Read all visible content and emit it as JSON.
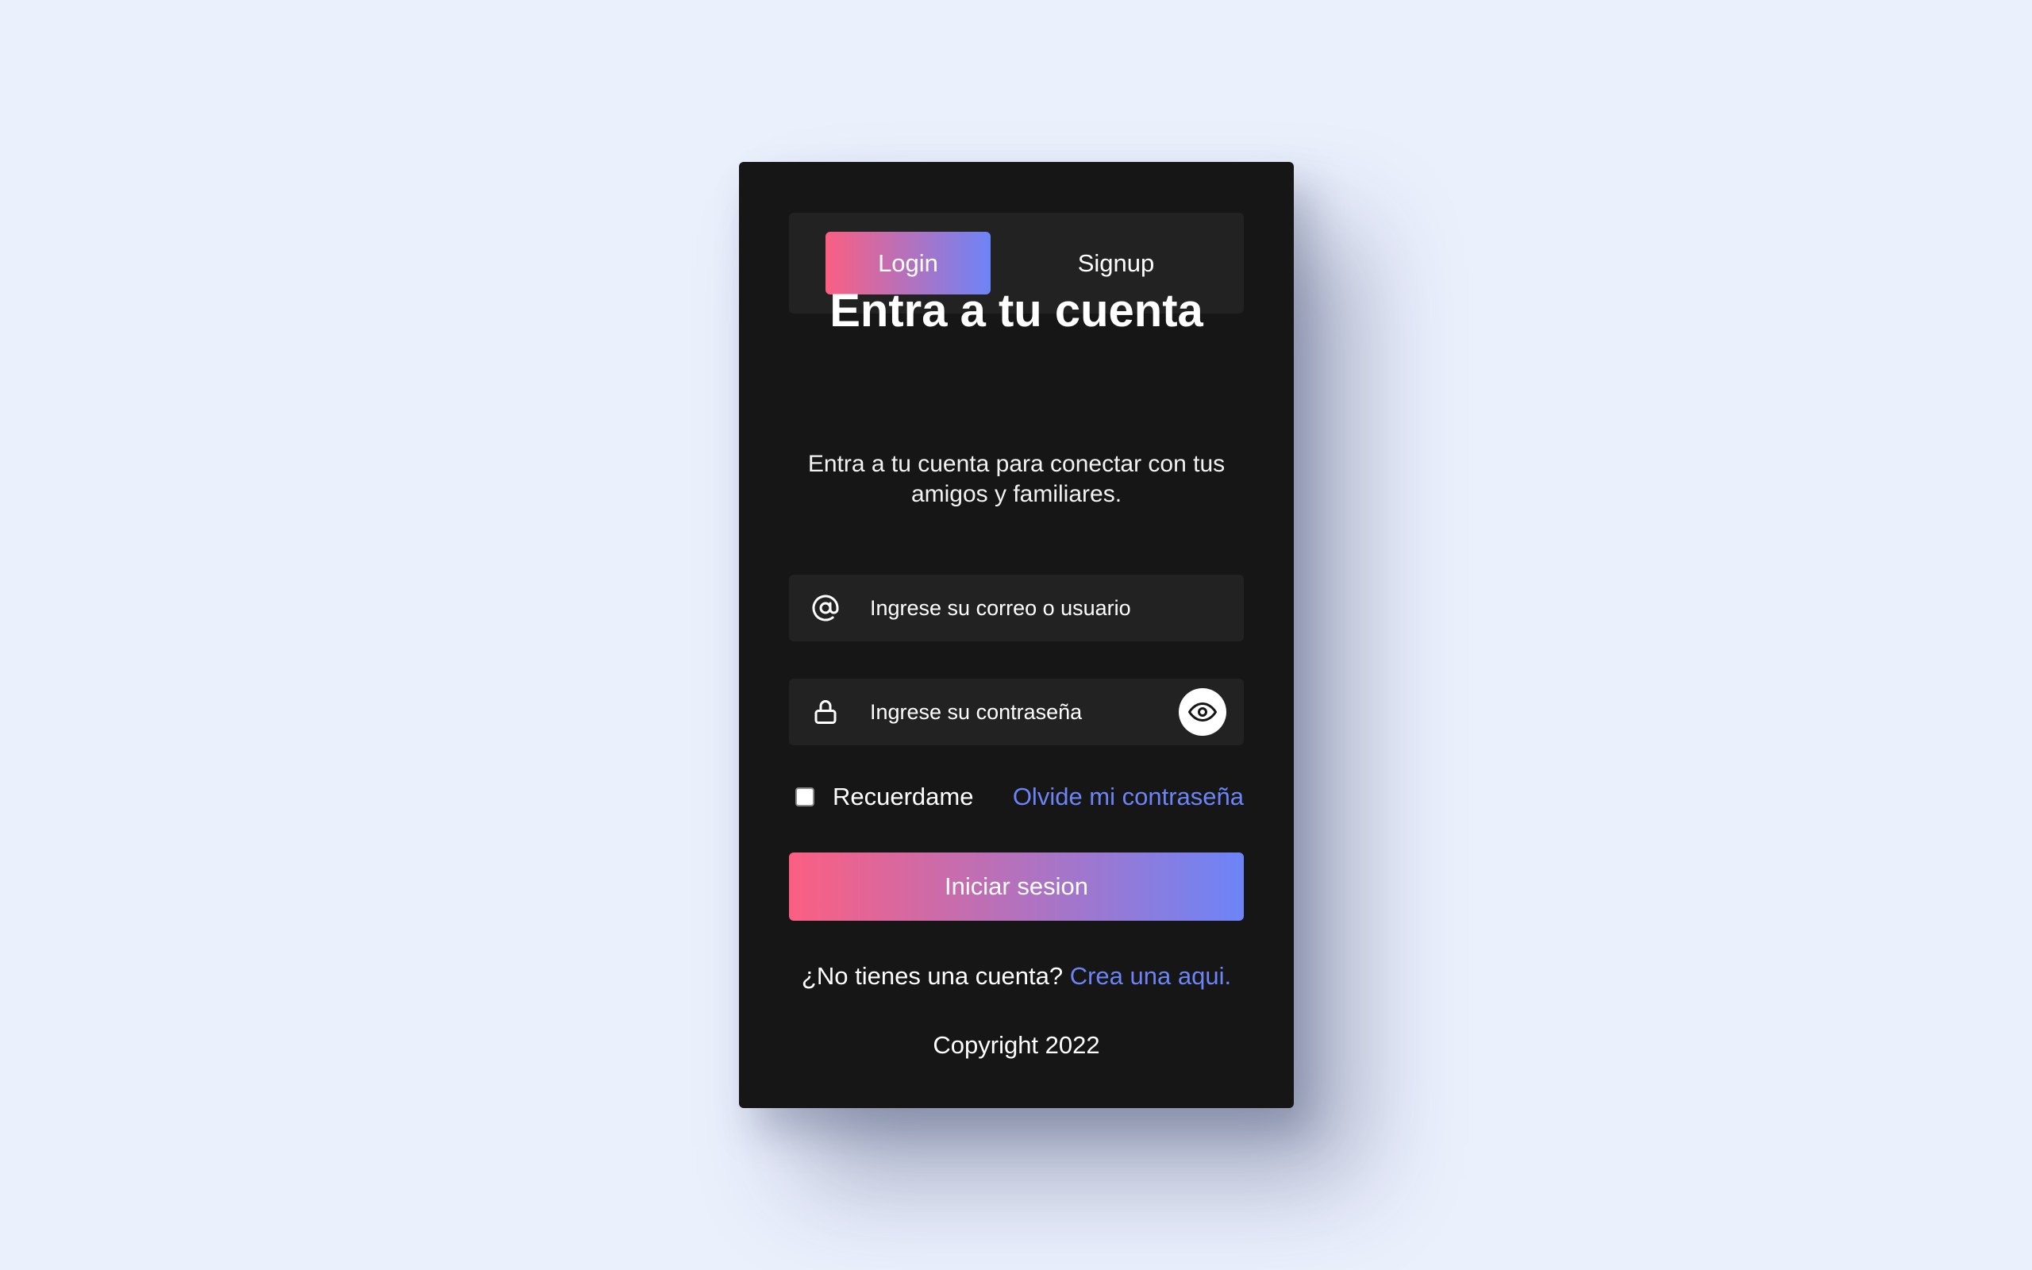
{
  "tabs": {
    "login_label": "Login",
    "signup_label": "Signup"
  },
  "header": {
    "title": "Entra a tu cuenta",
    "subtitle": "Entra a tu cuenta para conectar con tus amigos y familiares."
  },
  "form": {
    "email_placeholder": "Ingrese su correo o usuario",
    "email_value": "",
    "email_icon": "at-icon",
    "password_placeholder": "Ingrese su contraseña",
    "password_value": "",
    "password_icon": "lock-icon",
    "toggle_icon": "eye-icon",
    "remember_label": "Recuerdame",
    "remember_checked": false,
    "forgot_label": "Olvide mi contraseña",
    "submit_label": "Iniciar sesion"
  },
  "footer": {
    "no_account_text": "¿No tienes una cuenta?",
    "create_link": "Crea una aqui.",
    "copyright": "Copyright 2022"
  },
  "colors": {
    "background": "#ebf0fd",
    "card": "#161616",
    "input_bg": "#222222",
    "gradient_start": "#fb5f82",
    "gradient_end": "#6d84f7",
    "link": "#6d84f7"
  }
}
